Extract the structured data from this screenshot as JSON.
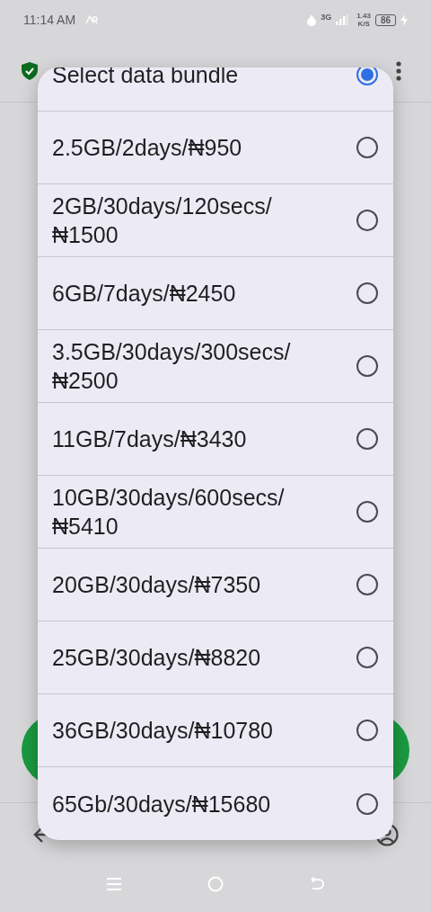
{
  "status_bar": {
    "time": "11:14 AM",
    "network": "3G",
    "speed": "1.43",
    "speed_unit": "K/S",
    "battery": "86"
  },
  "bundles": [
    {
      "lines": [
        "Select data bundle"
      ],
      "selected": true
    },
    {
      "lines": [
        "2.5GB/2days/₦950"
      ],
      "selected": false
    },
    {
      "lines": [
        "2GB/30days/120secs/",
        "₦1500"
      ],
      "selected": false
    },
    {
      "lines": [
        "6GB/7days/₦2450"
      ],
      "selected": false
    },
    {
      "lines": [
        "3.5GB/30days/300secs/",
        "₦2500"
      ],
      "selected": false
    },
    {
      "lines": [
        "11GB/7days/₦3430"
      ],
      "selected": false
    },
    {
      "lines": [
        "10GB/30days/600secs/",
        "₦5410"
      ],
      "selected": false
    },
    {
      "lines": [
        "20GB/30days/₦7350"
      ],
      "selected": false
    },
    {
      "lines": [
        "25GB/30days/₦8820"
      ],
      "selected": false
    },
    {
      "lines": [
        "36GB/30days/₦10780"
      ],
      "selected": false
    },
    {
      "lines": [
        "65Gb/30days/₦15680"
      ],
      "selected": false
    }
  ]
}
